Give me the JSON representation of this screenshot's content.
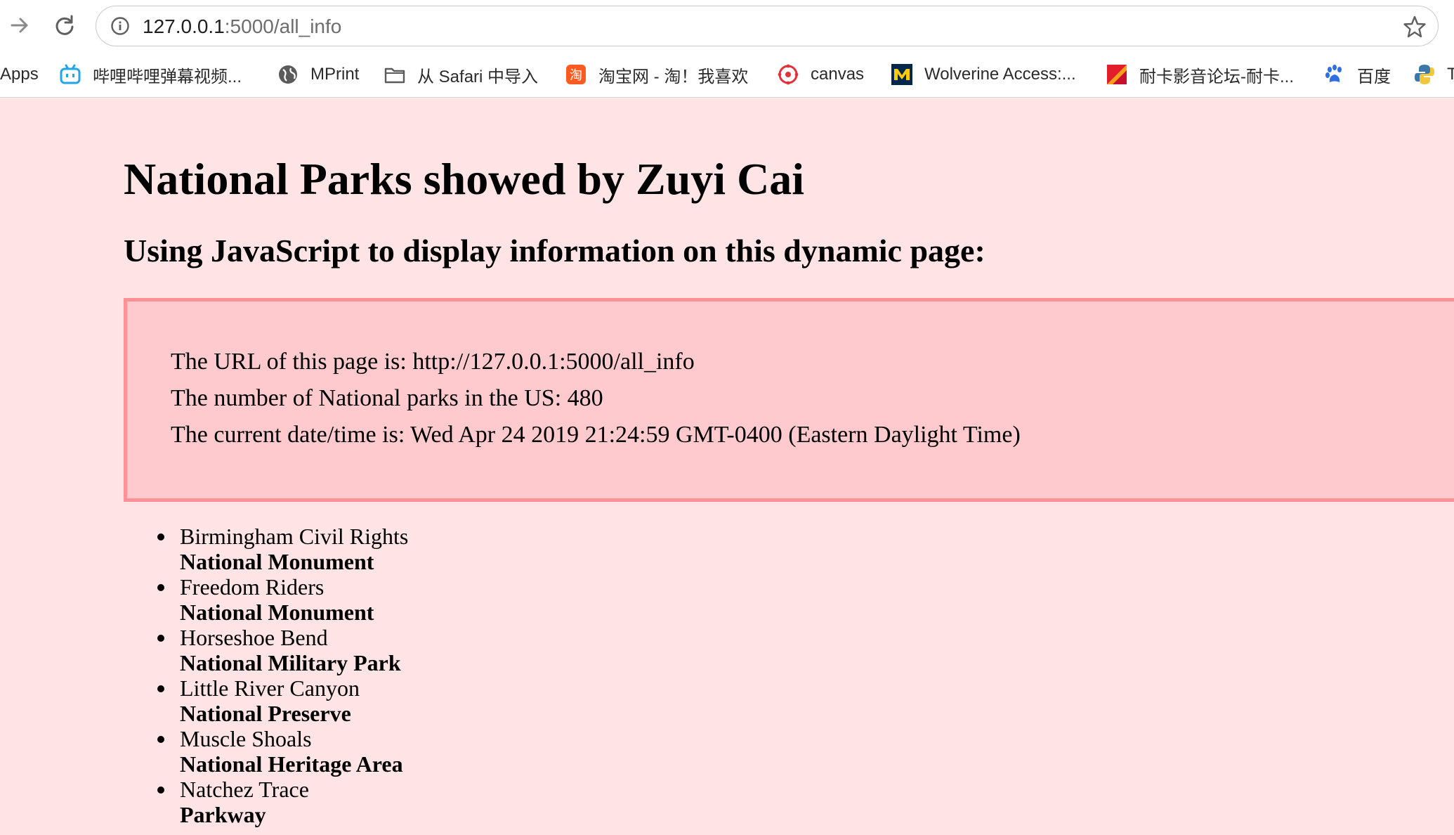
{
  "browser": {
    "url_host": "127.0.0.1",
    "url_path": ":5000/all_info",
    "bookmarks": [
      {
        "label": "Apps",
        "icon": "apps-grid-icon"
      },
      {
        "label": "哔哩哔哩弹幕视频...",
        "icon": "bilibili-icon"
      },
      {
        "label": "MPrint",
        "icon": "globe-icon"
      },
      {
        "label": "从 Safari 中导入",
        "icon": "folder-icon"
      },
      {
        "label": "淘宝网 - 淘！我喜欢",
        "icon": "taobao-icon"
      },
      {
        "label": "canvas",
        "icon": "canvas-icon"
      },
      {
        "label": "Wolverine Access:...",
        "icon": "michigan-m-icon"
      },
      {
        "label": "耐卡影音论坛-耐卡...",
        "icon": "nike-forum-icon"
      },
      {
        "label": "百度",
        "icon": "baidu-paw-icon"
      },
      {
        "label": "T",
        "icon": "python-icon"
      }
    ]
  },
  "page": {
    "title": "National Parks showed by Zuyi Cai",
    "subtitle": "Using JavaScript to display information on this dynamic page:",
    "info": {
      "url_line": "The URL of this page is: http://127.0.0.1:5000/all_info",
      "count_line": "The number of National parks in the US: 480",
      "time_line": "The current date/time is: Wed Apr 24 2019 21:24:59 GMT-0400 (Eastern Daylight Time)"
    },
    "parks": [
      {
        "name": "Birmingham Civil Rights",
        "designation": "National Monument"
      },
      {
        "name": "Freedom Riders",
        "designation": "National Monument"
      },
      {
        "name": "Horseshoe Bend",
        "designation": "National Military Park"
      },
      {
        "name": "Little River Canyon",
        "designation": "National Preserve"
      },
      {
        "name": "Muscle Shoals",
        "designation": "National Heritage Area"
      },
      {
        "name": "Natchez Trace",
        "designation": "Parkway"
      }
    ]
  },
  "colors": {
    "page_bg": "#ffe4e6",
    "box_bg": "#fecacd",
    "box_border": "#ff9196"
  }
}
